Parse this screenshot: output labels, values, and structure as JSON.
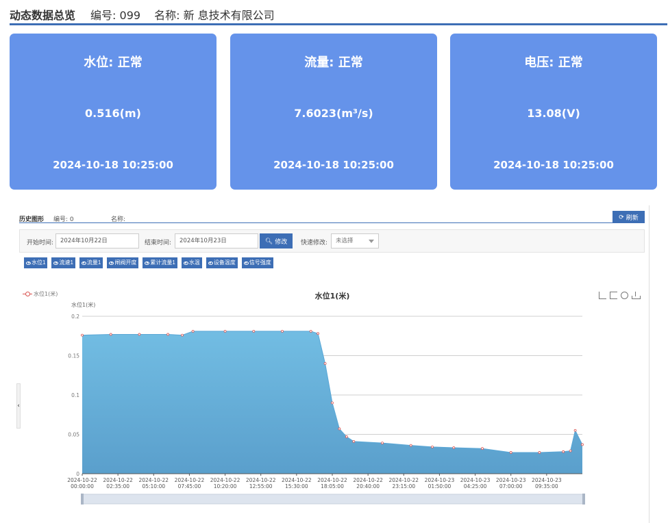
{
  "header": {
    "title": "动态数据总览",
    "number_label": "编号:",
    "number_value": "099",
    "name_label": "名称:",
    "name_value": "新",
    "name_suffix": "息技术有限公司"
  },
  "cards": [
    {
      "title": "水位:  正常",
      "value": "0.516(m)",
      "time": "2024-10-18 10:25:00"
    },
    {
      "title": "流量:  正常",
      "value": "7.6023(m³/s)",
      "time": "2024-10-18 10:25:00"
    },
    {
      "title": "电压:  正常",
      "value": "13.08(V)",
      "time": "2024-10-18 10:25:00"
    }
  ],
  "history": {
    "title": "历史图形",
    "number_label": "编号:  0",
    "name_label": "名称:",
    "refresh_label": "刷新"
  },
  "filters": {
    "start_label": "开始时间:",
    "start_value": "2024年10月22日",
    "end_label": "结束时间:",
    "end_value": "2024年10月23日",
    "query_label": "修改",
    "quick_label": "快速修改:",
    "quick_value": "未选择"
  },
  "tags": [
    "水位1",
    "流速1",
    "流量1",
    "闸阀开度",
    "累计流量1",
    "水温",
    "设备温度",
    "信号强度"
  ],
  "colors": {
    "accent": "#3d6eb5",
    "card": "#6593ea",
    "area": "#66b5de",
    "line_points": "#d9534f"
  },
  "icons": {
    "refresh": "refresh-icon",
    "query": "search-icon",
    "toolbox": [
      "zoom-icon",
      "zoom-back-icon",
      "restore-icon",
      "save-image-icon"
    ]
  },
  "chart_data": {
    "type": "area",
    "title": "水位1(米)",
    "ylabel": "水位1(米)",
    "legend": [
      "水位1(米)"
    ],
    "legend_position": "top-left",
    "grid": true,
    "ylim": [
      0,
      0.2
    ],
    "yticks": [
      "0",
      "0.05",
      "0.1",
      "0.15",
      "0.2"
    ],
    "xtick_labels": [
      [
        "2024-10-22",
        "00:00:00"
      ],
      [
        "2024-10-22",
        "02:35:00"
      ],
      [
        "2024-10-22",
        "05:10:00"
      ],
      [
        "2024-10-22",
        "07:45:00"
      ],
      [
        "2024-10-22",
        "10:20:00"
      ],
      [
        "2024-10-22",
        "12:55:00"
      ],
      [
        "2024-10-22",
        "15:30:00"
      ],
      [
        "2024-10-22",
        "18:05:00"
      ],
      [
        "2024-10-22",
        "20:40:00"
      ],
      [
        "2024-10-22",
        "23:15:00"
      ],
      [
        "2024-10-23",
        "01:50:00"
      ],
      [
        "2024-10-23",
        "04:25:00"
      ],
      [
        "2024-10-23",
        "07:00:00"
      ],
      [
        "2024-10-23",
        "09:35:00"
      ]
    ],
    "series": [
      {
        "name": "水位1(米)",
        "x": [
          "2024-10-22 00:00",
          "2024-10-22 02:00",
          "2024-10-22 04:00",
          "2024-10-22 06:00",
          "2024-10-22 07:00",
          "2024-10-22 07:45",
          "2024-10-22 10:00",
          "2024-10-22 12:00",
          "2024-10-22 14:00",
          "2024-10-22 16:00",
          "2024-10-22 16:30",
          "2024-10-22 17:00",
          "2024-10-22 17:30",
          "2024-10-22 18:00",
          "2024-10-22 18:30",
          "2024-10-22 19:00",
          "2024-10-22 21:00",
          "2024-10-22 23:00",
          "2024-10-23 00:30",
          "2024-10-23 02:00",
          "2024-10-23 04:00",
          "2024-10-23 06:00",
          "2024-10-23 08:00",
          "2024-10-23 09:40",
          "2024-10-23 10:10",
          "2024-10-23 10:30",
          "2024-10-23 11:00"
        ],
        "values": [
          0.176,
          0.177,
          0.177,
          0.177,
          0.176,
          0.181,
          0.181,
          0.181,
          0.181,
          0.181,
          0.178,
          0.14,
          0.09,
          0.057,
          0.047,
          0.041,
          0.039,
          0.036,
          0.034,
          0.033,
          0.032,
          0.027,
          0.027,
          0.028,
          0.029,
          0.055,
          0.037
        ]
      }
    ]
  }
}
